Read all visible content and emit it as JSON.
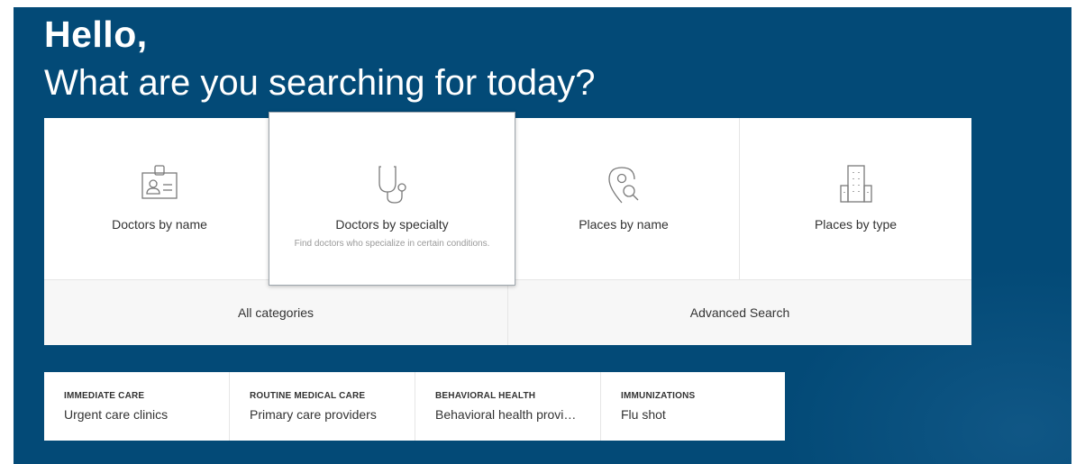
{
  "greeting": {
    "hello": "Hello,",
    "question": "What are you searching for today?"
  },
  "categories": [
    {
      "label": "Doctors by name",
      "icon": "id-badge-icon"
    },
    {
      "label": "Doctors by specialty",
      "description": "Find doctors who specialize in certain conditions.",
      "icon": "stethoscope-icon"
    },
    {
      "label": "Places by name",
      "icon": "location-search-icon"
    },
    {
      "label": "Places by type",
      "icon": "building-icon"
    }
  ],
  "links": {
    "all_categories": "All categories",
    "advanced_search": "Advanced Search"
  },
  "quick_links": [
    {
      "heading": "IMMEDIATE CARE",
      "value": "Urgent care clinics"
    },
    {
      "heading": "ROUTINE MEDICAL CARE",
      "value": "Primary care providers"
    },
    {
      "heading": "BEHAVIORAL HEALTH",
      "value": "Behavioral health provi…"
    },
    {
      "heading": "IMMUNIZATIONS",
      "value": "Flu shot"
    }
  ],
  "colors": {
    "background": "#034a77",
    "panel": "#ffffff",
    "text": "#333333",
    "muted": "#999999"
  }
}
